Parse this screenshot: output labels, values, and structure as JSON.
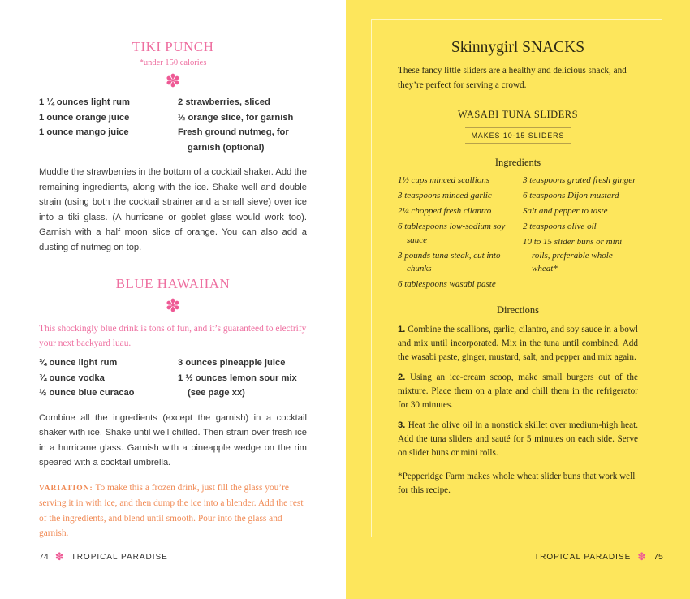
{
  "left_page": {
    "tiki_punch": {
      "title": "TIKI PUNCH",
      "subtitle": "*under 150 calories",
      "ingredients_left": [
        "1 ¼ ounces light rum",
        "1 ounce orange juice",
        "1 ounce mango juice"
      ],
      "ingredients_right": [
        "2 strawberries, sliced",
        "½ orange slice, for garnish",
        "Fresh ground nutmeg, for garnish (optional)"
      ],
      "directions": "Muddle the strawberries in the bottom of a cocktail shaker. Add the remaining ingredients, along with the ice. Shake well and double strain (using both the cocktail strainer and a small sieve) over ice into a tiki glass. (A hurricane or goblet glass would work too). Garnish with a half moon slice of orange. You can also add a dusting of nutmeg on top."
    },
    "blue_hawaiian": {
      "title": "BLUE HAWAIIAN",
      "intro": "This shockingly blue drink is tons of fun, and it’s guaranteed to electrify your next backyard luau.",
      "ingredients_left": [
        "¾ ounce light rum",
        "¾ ounce vodka",
        "½ ounce blue curacao"
      ],
      "ingredients_right": [
        "3 ounces pineapple juice",
        "1 ½ ounces lemon sour mix (see page xx)"
      ],
      "directions": "Combine all the ingredients (except the garnish) in a cocktail shaker with ice. Shake until well chilled. Then strain over fresh ice in a hurricane glass. Garnish with a pineapple wedge on the rim speared with a cocktail umbrella.",
      "variation_label": "VARIATION:",
      "variation_text": " To make this a frozen drink, just fill the glass you’re serving it in with ice, and then dump the ice into a blender. Add the rest of the ingredients, and blend until smooth. Pour into the glass and garnish."
    },
    "footer": {
      "page_number": "74",
      "running_head": "TROPICAL PARADISE"
    }
  },
  "right_page": {
    "title": "Skinnygirl SNACKS",
    "intro": "These fancy little sliders are a healthy and delicious snack, and they’re perfect for serving a crowd.",
    "recipe_title": "WASABI TUNA SLIDERS",
    "makes": "MAKES 10-15 SLIDERS",
    "ingredients_heading": "Ingredients",
    "ingredients_left": [
      "1½ cups minced scallions",
      "3 teaspoons minced garlic",
      "2¼ chopped fresh cilantro",
      "6 tablespoons low-sodium soy sauce",
      "3 pounds tuna steak, cut into chunks",
      "6 tablespoons wasabi paste"
    ],
    "ingredients_right": [
      "3 teaspoons grated fresh ginger",
      "6 teaspoons Dijon mustard",
      "Salt and pepper to taste",
      "2 teaspoons olive oil",
      "10 to 15 slider buns or mini rolls, preferable whole wheat*"
    ],
    "directions_heading": "Directions",
    "steps": [
      {
        "num": "1.",
        "text": " Combine the scallions, garlic, cilantro, and soy sauce in a bowl and mix until incorporated. Mix in the tuna until combined. Add the wasabi paste, ginger, mustard, salt, and pepper and mix again."
      },
      {
        "num": "2.",
        "text": " Using an ice-cream scoop, make small burgers out of the mixture. Place them on a plate and chill them in the refrigerator for 30 minutes."
      },
      {
        "num": "3.",
        "text": " Heat the olive oil in a nonstick skillet over medium-high heat. Add the tuna sliders and sauté for 5 minutes on each side. Serve on slider buns or mini rolls."
      }
    ],
    "footnote": "*Pepperidge Farm makes whole wheat slider buns that work well for this recipe.",
    "footer": {
      "running_head": "TROPICAL PARADISE",
      "page_number": "75"
    }
  },
  "ornament_glyph": "✽",
  "colors": {
    "pink": "#ee6fa0",
    "orange": "#f08a55",
    "yellow": "#fde65c"
  }
}
